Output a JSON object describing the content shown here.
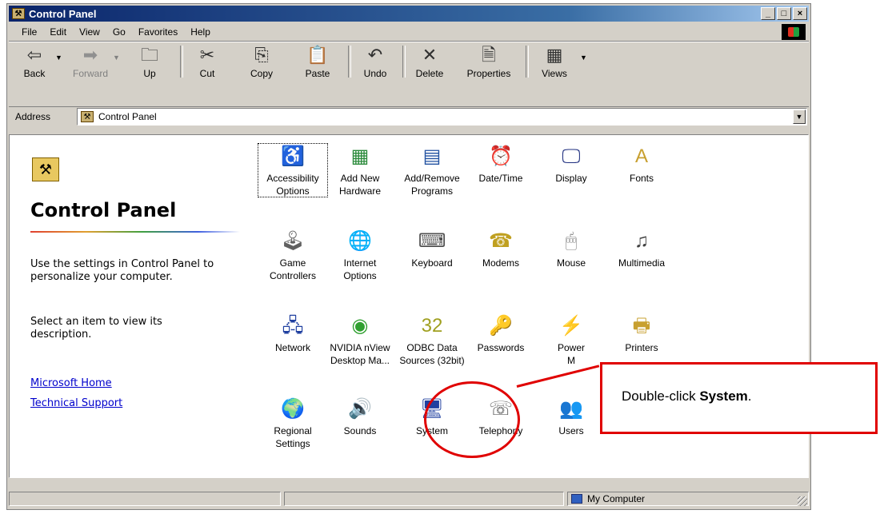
{
  "window": {
    "title": "Control Panel",
    "controls": [
      "_",
      "□",
      "×"
    ]
  },
  "menu": [
    "File",
    "Edit",
    "View",
    "Go",
    "Favorites",
    "Help"
  ],
  "toolbar": [
    {
      "label": "Back",
      "icon": "⇦"
    },
    {
      "label": "Forward",
      "icon": "➡"
    },
    {
      "label": "Up",
      "icon": "🗀"
    },
    {
      "label": "Cut",
      "icon": "✂"
    },
    {
      "label": "Copy",
      "icon": "⎘"
    },
    {
      "label": "Paste",
      "icon": "📋"
    },
    {
      "label": "Undo",
      "icon": "↶"
    },
    {
      "label": "Delete",
      "icon": "✕"
    },
    {
      "label": "Properties",
      "icon": "🗎"
    },
    {
      "label": "Views",
      "icon": "▦"
    }
  ],
  "address": {
    "label": "Address",
    "value": "Control Panel"
  },
  "panel": {
    "title": "Control Panel",
    "text1": "Use the settings in Control Panel to personalize your computer.",
    "text2": "Select an item to view its description.",
    "links": [
      "Microsoft Home",
      "Technical Support"
    ]
  },
  "items": [
    {
      "line1": "Accessibility",
      "line2": "Options",
      "icon": "♿",
      "color": "#2050c0"
    },
    {
      "line1": "Add New",
      "line2": "Hardware",
      "icon": "▦",
      "color": "#2a8a3a"
    },
    {
      "line1": "Add/Remove",
      "line2": "Programs",
      "icon": "▤",
      "color": "#2050a0"
    },
    {
      "line1": "Date/Time",
      "line2": "",
      "icon": "⏰",
      "color": "#c03020"
    },
    {
      "line1": "Display",
      "line2": "",
      "icon": "🖵",
      "color": "#203080"
    },
    {
      "line1": "Fonts",
      "line2": "",
      "icon": "A",
      "color": "#c8a030"
    },
    {
      "line1": "Game",
      "line2": "Controllers",
      "icon": "🕹",
      "color": "#606060"
    },
    {
      "line1": "Internet",
      "line2": "Options",
      "icon": "🌐",
      "color": "#208040"
    },
    {
      "line1": "Keyboard",
      "line2": "",
      "icon": "⌨",
      "color": "#505050"
    },
    {
      "line1": "Modems",
      "line2": "",
      "icon": "☎",
      "color": "#c0a020"
    },
    {
      "line1": "Mouse",
      "line2": "",
      "icon": "🖱",
      "color": "#808080"
    },
    {
      "line1": "Multimedia",
      "line2": "",
      "icon": "♫",
      "color": "#404040"
    },
    {
      "line1": "Network",
      "line2": "",
      "icon": "🖧",
      "color": "#2040a0"
    },
    {
      "line1": "NVIDIA nView",
      "line2": "Desktop Ma...",
      "icon": "◉",
      "color": "#30a030"
    },
    {
      "line1": "ODBC Data",
      "line2": "Sources (32bit)",
      "icon": "32",
      "color": "#a0a020"
    },
    {
      "line1": "Passwords",
      "line2": "",
      "icon": "🔑",
      "color": "#c0a020"
    },
    {
      "line1": "Power",
      "line2": "M",
      "icon": "⚡",
      "color": "#808080"
    },
    {
      "line1": "Printers",
      "line2": "",
      "icon": "🖶",
      "color": "#c8a030"
    },
    {
      "line1": "Regional",
      "line2": "Settings",
      "icon": "🌍",
      "color": "#209040"
    },
    {
      "line1": "Sounds",
      "line2": "",
      "icon": "🔊",
      "color": "#404040"
    },
    {
      "line1": "System",
      "line2": "",
      "icon": "🖥",
      "color": "#2040a0"
    },
    {
      "line1": "Telephony",
      "line2": "",
      "icon": "☏",
      "color": "#606060"
    },
    {
      "line1": "Users",
      "line2": "",
      "icon": "👥",
      "color": "#808080"
    }
  ],
  "status": {
    "zone": "My Computer"
  },
  "callout": {
    "text": "Double-click ",
    "bold": "System",
    "end": "."
  },
  "accent": "#e00000"
}
